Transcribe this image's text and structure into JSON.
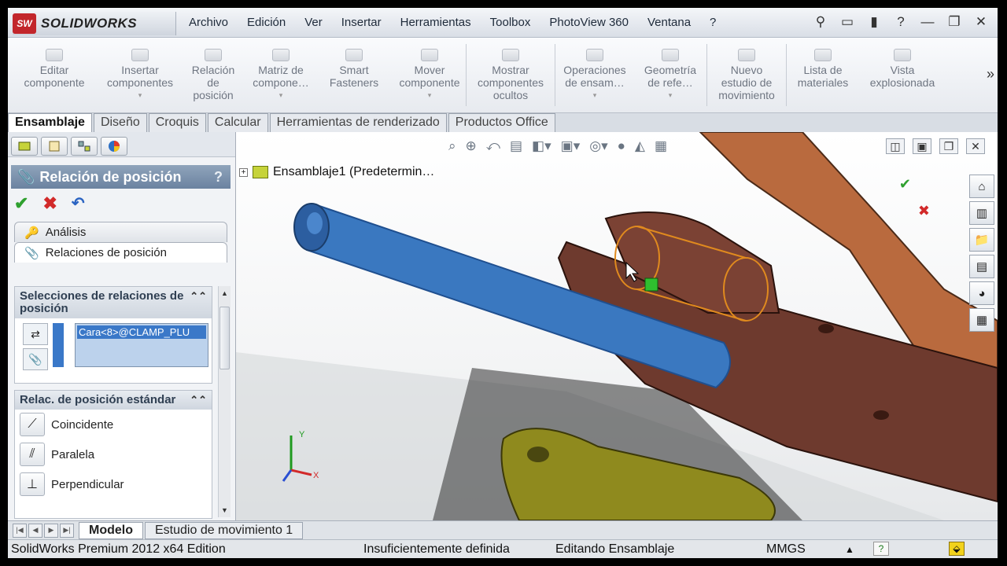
{
  "app": {
    "logo_badge": "SW",
    "logo_text": "SOLIDWORKS"
  },
  "menu": [
    "Archivo",
    "Edición",
    "Ver",
    "Insertar",
    "Herramientas",
    "Toolbox",
    "PhotoView 360",
    "Ventana",
    "?"
  ],
  "command_manager": {
    "commands": [
      {
        "label1": "Editar",
        "label2": "componente"
      },
      {
        "label1": "Insertar",
        "label2": "componentes",
        "arrow": "▾"
      },
      {
        "label1": "Relación",
        "label2": "de",
        "label3": "posición"
      },
      {
        "label1": "Matriz de",
        "label2": "compone…",
        "arrow": "▾"
      },
      {
        "label1": "Smart",
        "label2": "Fasteners"
      },
      {
        "label1": "Mover",
        "label2": "componente",
        "arrow": "▾"
      },
      {
        "label1": "Mostrar",
        "label2": "componentes",
        "label3": "ocultos"
      },
      {
        "label1": "Operaciones",
        "label2": "de ensam…",
        "arrow": "▾"
      },
      {
        "label1": "Geometría",
        "label2": "de refe…",
        "arrow": "▾"
      },
      {
        "label1": "Nuevo",
        "label2": "estudio de",
        "label3": "movimiento"
      },
      {
        "label1": "Lista de",
        "label2": "materiales"
      },
      {
        "label1": "Vista",
        "label2": "explosionada"
      }
    ],
    "more": "»"
  },
  "tabs": [
    "Ensamblaje",
    "Diseño",
    "Croquis",
    "Calcular",
    "Herramientas de renderizado",
    "Productos Office"
  ],
  "property_manager": {
    "title": "Relación de posición",
    "help": "?",
    "analysis_tab": "Análisis",
    "mates_tab": "Relaciones de posición",
    "selections_group": "Selecciones de relaciones de posición",
    "selection_item": "Cara<8>@CLAMP_PLU",
    "standard_group": "Relac. de posición estándar",
    "standard_mates": [
      "Coincidente",
      "Paralela",
      "Perpendicular"
    ]
  },
  "viewport": {
    "tree_node": "Ensamblaje1  (Predetermin…",
    "triad_x": "X",
    "triad_y": "Y"
  },
  "bottom_tabs": [
    "Modelo",
    "Estudio de movimiento 1"
  ],
  "status": {
    "edition": "SolidWorks Premium 2012 x64 Edition",
    "definition": "Insuficientemente definida",
    "mode": "Editando Ensamblaje",
    "units": "MMGS",
    "units_arrow": "▲",
    "help": "?"
  },
  "colors": {
    "pin_blue": "#3a78c0",
    "bracket_brown": "#6e3a2e",
    "arm_copper": "#b96a3e",
    "link_olive": "#8f8a1e",
    "highlight_orange": "#e08a1e"
  }
}
